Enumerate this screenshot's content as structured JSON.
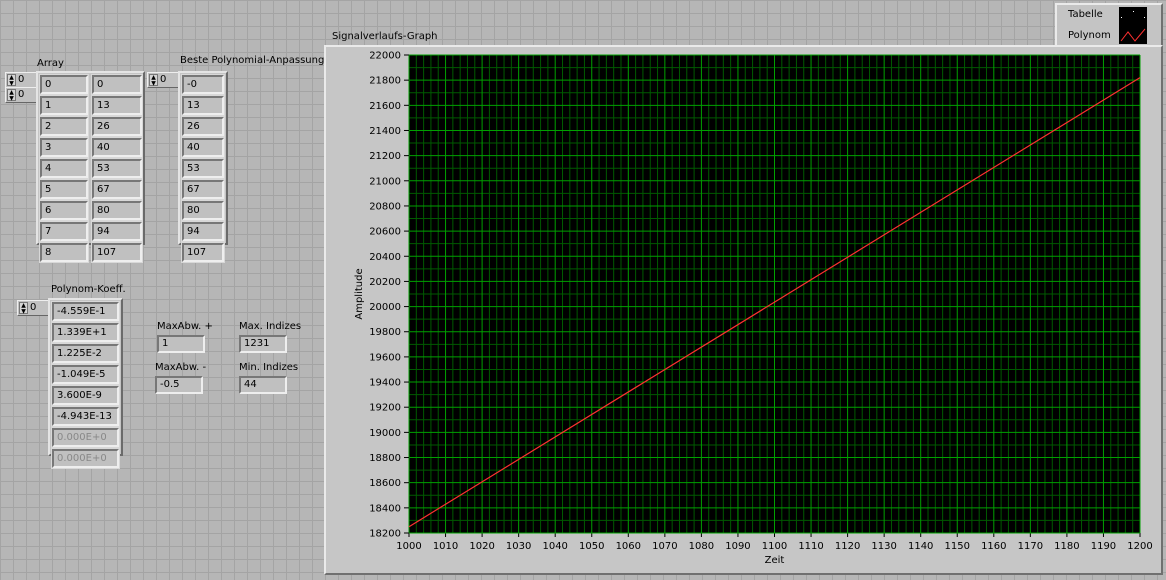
{
  "array": {
    "label": "Array",
    "index_row": "0",
    "index_col": "0",
    "col0": [
      "0",
      "1",
      "2",
      "3",
      "4",
      "5",
      "6",
      "7",
      "8"
    ],
    "col1": [
      "0",
      "13",
      "26",
      "40",
      "53",
      "67",
      "80",
      "94",
      "107"
    ]
  },
  "best_fit": {
    "label": "Beste Polynomial-Anpassung",
    "index": "0",
    "values": [
      "-0",
      "13",
      "26",
      "40",
      "53",
      "67",
      "80",
      "94",
      "107"
    ]
  },
  "coeff": {
    "label": "Polynom-Koeff.",
    "index": "0",
    "values": [
      "-4.559E-1",
      "1.339E+1",
      "1.225E-2",
      "-1.049E-5",
      "3.600E-9",
      "-4.943E-13",
      "0.000E+0",
      "0.000E+0"
    ],
    "disabled_from": 6
  },
  "max_abw_plus": {
    "label": "MaxAbw. +",
    "value": "1"
  },
  "max_abw_minus": {
    "label": "MaxAbw. -",
    "value": "-0.5"
  },
  "max_indizes": {
    "label": "Max. Indizes",
    "value": "1231"
  },
  "min_indizes": {
    "label": "Min. Indizes",
    "value": "44"
  },
  "legend": {
    "items": [
      "Tabelle",
      "Polynom"
    ]
  },
  "colors": {
    "plot_bg": "#000000",
    "major_grid": "#00a000",
    "minor_grid": "#005a00",
    "polynom": "#ff3030",
    "tabelle": "#ffffff"
  },
  "chart_data": {
    "type": "line",
    "title": "Signalverlaufs-Graph",
    "xlabel": "Zeit",
    "ylabel": "Amplitude",
    "xlim": [
      1000,
      1200
    ],
    "ylim": [
      18200,
      22000
    ],
    "xticks": [
      1000,
      1010,
      1020,
      1030,
      1040,
      1050,
      1060,
      1070,
      1080,
      1090,
      1100,
      1110,
      1120,
      1130,
      1140,
      1150,
      1160,
      1170,
      1180,
      1190,
      1200
    ],
    "yticks": [
      18200,
      18400,
      18600,
      18800,
      19000,
      19200,
      19400,
      19600,
      19800,
      20000,
      20200,
      20400,
      20600,
      20800,
      21000,
      21200,
      21400,
      21600,
      21800,
      22000
    ],
    "series": [
      {
        "name": "Polynom",
        "x": [
          1000,
          1200
        ],
        "y": [
          18250,
          21820
        ]
      }
    ]
  }
}
